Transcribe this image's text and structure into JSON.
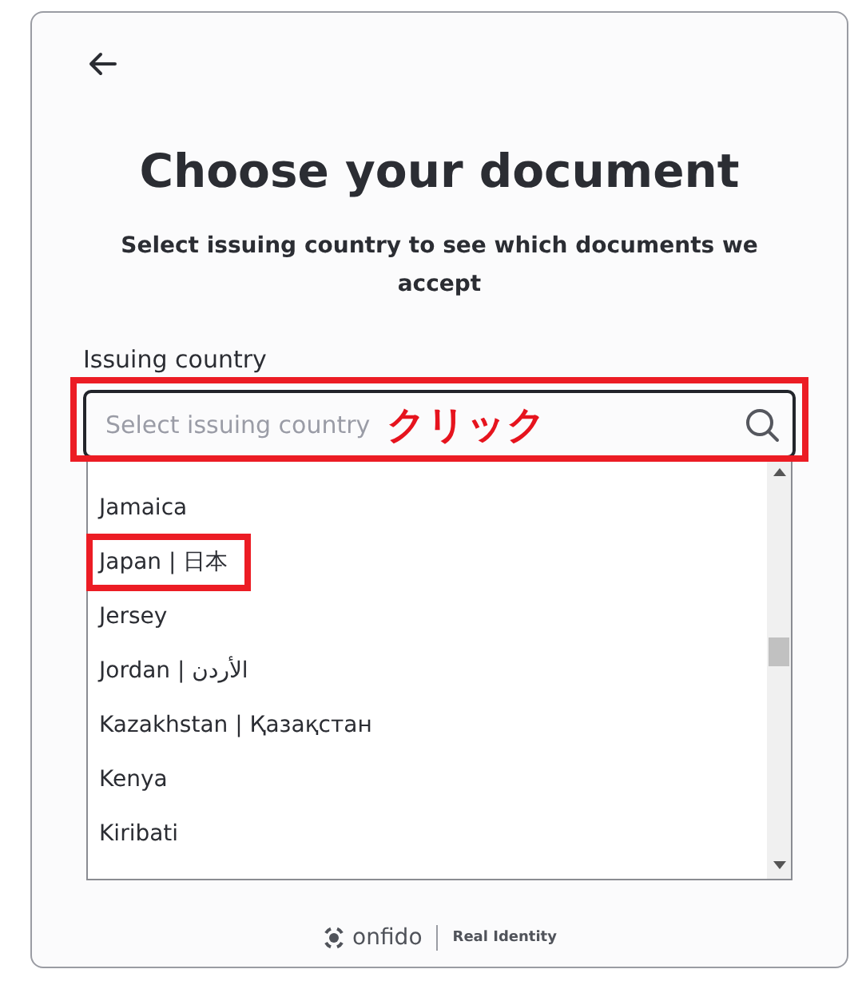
{
  "title": "Choose your document",
  "subtitle": "Select issuing country to see which documents we accept",
  "field": {
    "label": "Issuing country",
    "placeholder": "Select issuing country",
    "annotated": true,
    "annotation": "クリック"
  },
  "countries": [
    {
      "name": "Jamaica",
      "annotated": false
    },
    {
      "name": "Japan | 日本",
      "annotated": true
    },
    {
      "name": "Jersey",
      "annotated": false
    },
    {
      "name": "Jordan | الأردن",
      "annotated": false
    },
    {
      "name": "Kazakhstan | Қазақстан",
      "annotated": false
    },
    {
      "name": "Kenya",
      "annotated": false
    },
    {
      "name": "Kiribati",
      "annotated": false
    }
  ],
  "footer": {
    "brand": "onfido",
    "tagline": "Real Identity"
  }
}
